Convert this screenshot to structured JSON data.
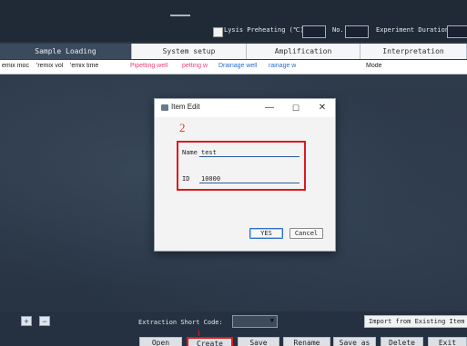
{
  "header": {
    "lysis_label": "Lysis Preheating (℃)",
    "no_label": "No.",
    "duration_label": "Experiment Duration"
  },
  "tabs": [
    {
      "label": "Sample Loading",
      "active": true
    },
    {
      "label": "System setup",
      "active": false
    },
    {
      "label": "Amplification",
      "active": false
    },
    {
      "label": "Interpretation",
      "active": false
    }
  ],
  "columns": [
    {
      "label": "emix moc",
      "color": "#222222"
    },
    {
      "label": "'remix vol",
      "color": "#222222"
    },
    {
      "label": "'emix time",
      "color": "#222222"
    },
    {
      "label": "Pipetting well",
      "color": "#e8427a"
    },
    {
      "label": "petting w",
      "color": "#e8427a"
    },
    {
      "label": "Drainage well",
      "color": "#2a6fd0"
    },
    {
      "label": "rainage w",
      "color": "#2a6fd0"
    },
    {
      "label": "Mode",
      "color": "#222222"
    }
  ],
  "dialog": {
    "title": "Item Edit",
    "step_number": "2",
    "name_label": "Name",
    "name_value": "test",
    "id_label": "ID",
    "id_value": "10000",
    "yes_label": "YES",
    "cancel_label": "Cancel",
    "minimize_glyph": "—",
    "maximize_glyph": "☐",
    "close_glyph": "✕"
  },
  "bottom": {
    "add_glyph": "+",
    "remove_glyph": "−",
    "short_code_label": "Extraction Short Code:",
    "combo_arrow": "▼",
    "import_label": "Import from Existing Item",
    "actions": [
      "Open",
      "Create",
      "Save",
      "Rename",
      "Save as",
      "Delete",
      "Exit"
    ]
  },
  "colors": {
    "accent_red": "#e0181c",
    "app_background": "#2b3746",
    "active_tab": "#3b4a5c"
  }
}
